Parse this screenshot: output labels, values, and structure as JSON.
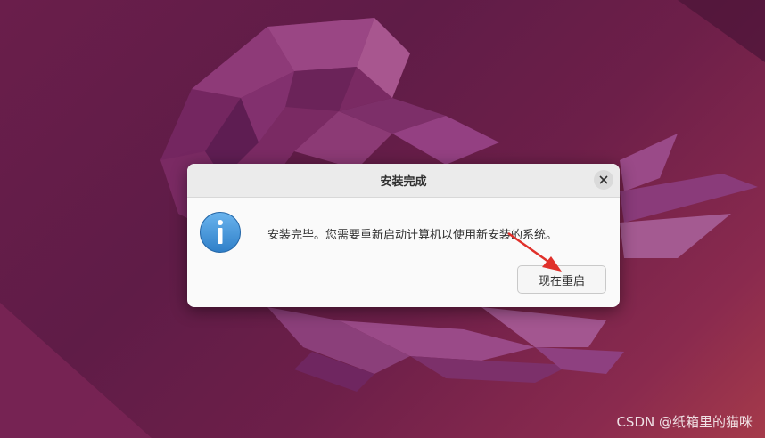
{
  "dialog": {
    "title": "安装完成",
    "message": "安装完毕。您需要重新启动计算机以使用新安装的系统。",
    "restart_label": "现在重启",
    "close_icon": "close-icon",
    "info_icon": "info-icon"
  },
  "watermark": "CSDN @纸箱里的猫咪",
  "colors": {
    "wallpaper": "#6a1e4b",
    "dialog_bg": "#fafafa",
    "titlebar_bg": "#ebebeb",
    "info_blue": "#3a8fd6",
    "annotation_arrow": "#e0302a"
  }
}
